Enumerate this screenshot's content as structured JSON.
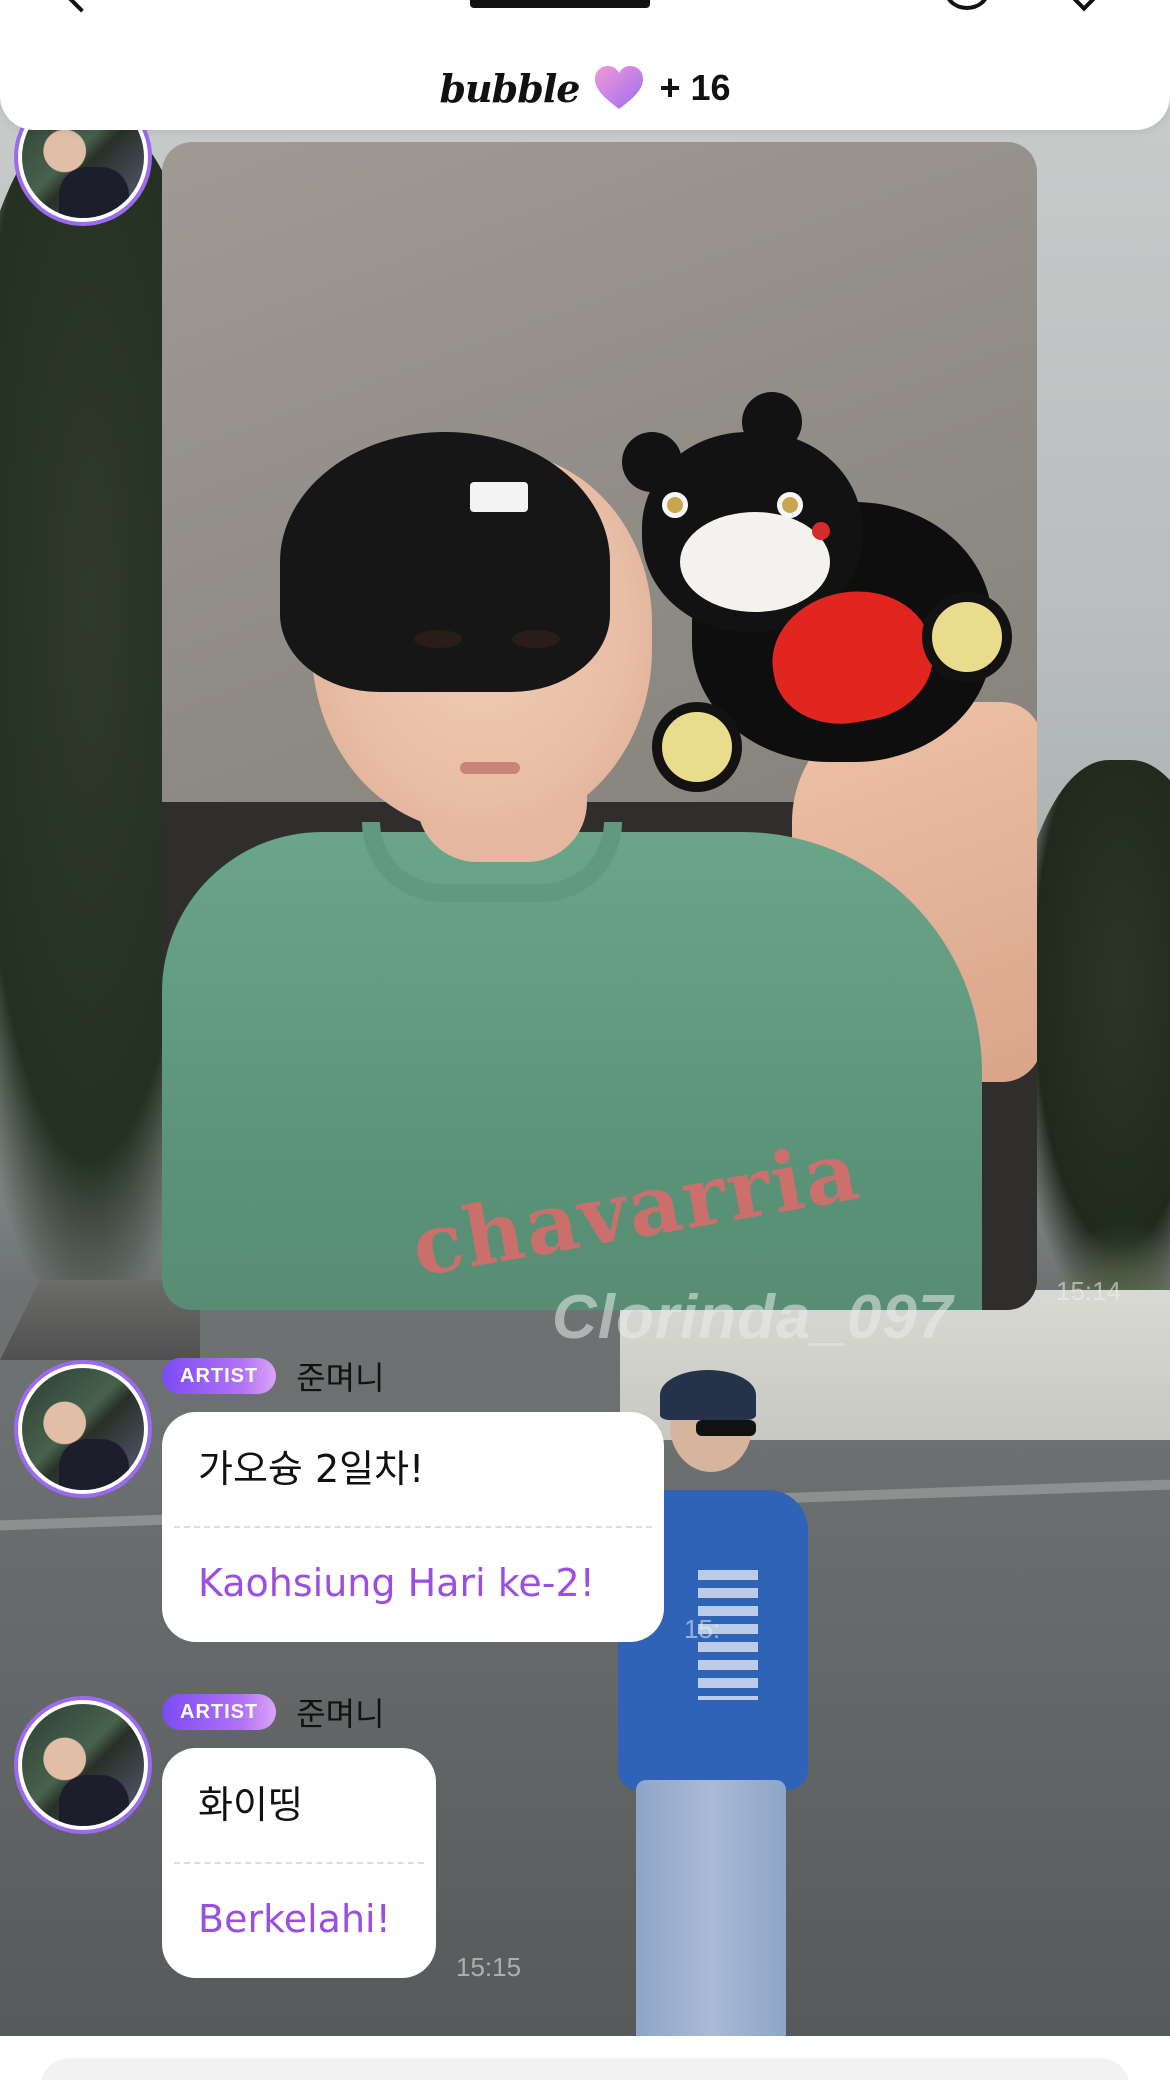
{
  "header": {
    "bubble_logo": "bubble",
    "bubble_count": "+ 16",
    "icons": [
      "back-icon",
      "search-icon",
      "menu-icon",
      "heart-icon"
    ]
  },
  "photo_message": {
    "watermark": "Clorinda_097",
    "time": "15:14"
  },
  "messages": [
    {
      "badge": "ARTIST",
      "sender": "준며니",
      "text": "가오슝 2일차!",
      "translation": "Kaohsiung Hari ke-2!",
      "time": "15:"
    },
    {
      "badge": "ARTIST",
      "sender": "준며니",
      "text": "화이띵",
      "translation": "Berkelahi!",
      "time": "15:15"
    }
  ],
  "colors": {
    "accent_purple": "#9a4fe2",
    "badge_gradient_start": "#7c4cf2",
    "badge_gradient_end": "#dca4f6",
    "avatar_ring": "#9b6af0",
    "heart_gradient_start": "#f29ad6",
    "heart_gradient_end": "#9c6cf2"
  }
}
